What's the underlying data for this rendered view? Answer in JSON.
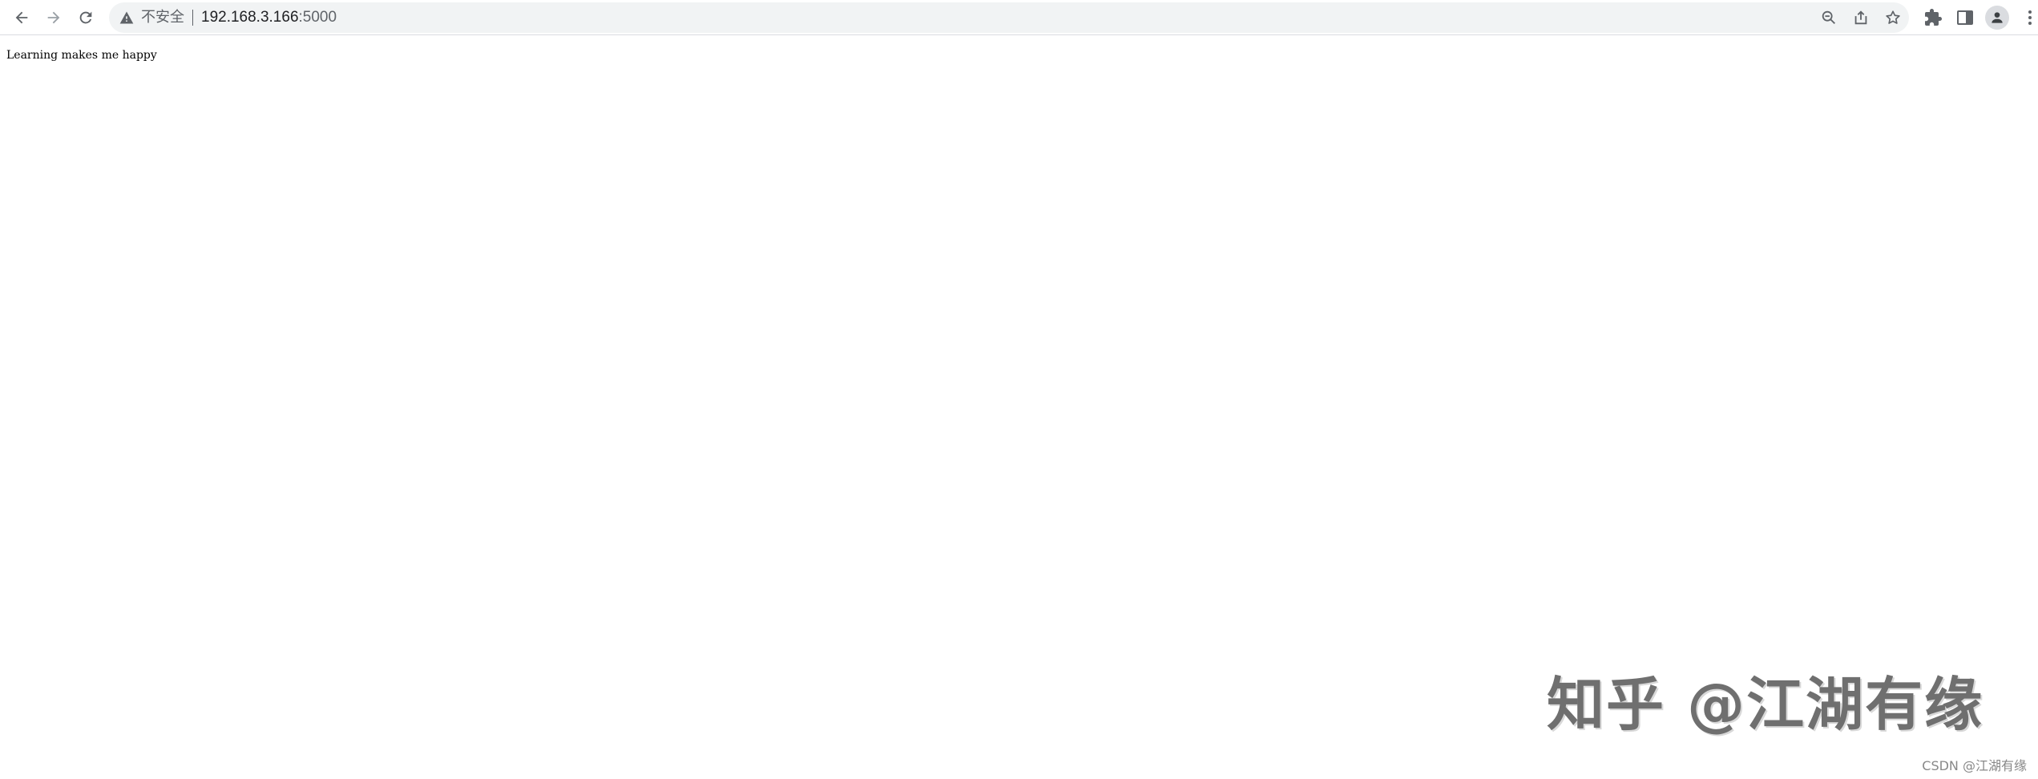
{
  "browser": {
    "security_label": "不安全",
    "url_host": "192.168.3.166",
    "url_port": ":5000",
    "icons": {
      "back": "arrow-left-icon",
      "forward": "arrow-right-icon",
      "reload": "reload-icon",
      "warning": "warning-triangle-icon",
      "zoom": "zoom-out-icon",
      "share": "share-icon",
      "bookmark": "star-icon",
      "extensions": "puzzle-icon",
      "side_panel": "side-panel-icon",
      "profile": "profile-icon",
      "menu": "kebab-menu-icon"
    }
  },
  "page": {
    "body_text": "Learning makes me happy"
  },
  "overlay": {
    "watermark": "知乎 @江湖有缘",
    "credit": "CSDN @江湖有缘"
  },
  "colors": {
    "toolbar_icon": "#5f6368",
    "omnibox_bg": "#f1f3f4",
    "text": "#202124"
  }
}
